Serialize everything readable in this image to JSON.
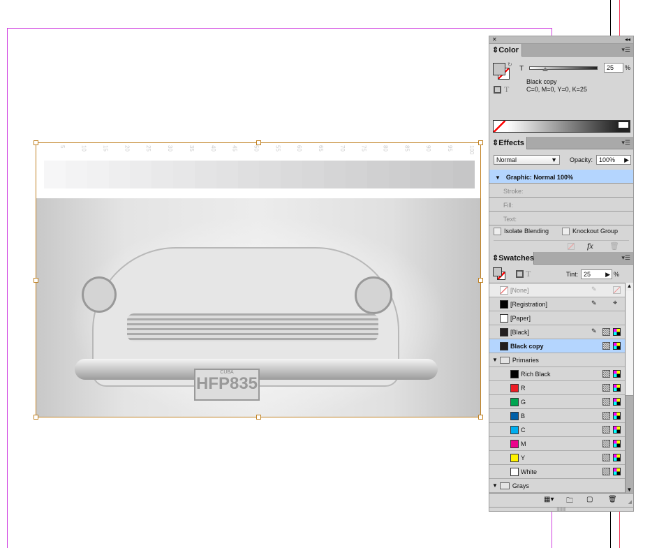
{
  "canvas": {
    "gradient_ticks": [
      "5",
      "10",
      "15",
      "20",
      "25",
      "30",
      "35",
      "40",
      "45",
      "50",
      "55",
      "60",
      "65",
      "70",
      "75",
      "80",
      "85",
      "90",
      "95",
      "100"
    ],
    "license_plate": "HFP835",
    "plate_top": "CUBA"
  },
  "panel": {
    "color": {
      "tab": "Color",
      "slider_label": "T",
      "tint_value": "25",
      "percent": "%",
      "swatch_name": "Black copy",
      "values": "C=0, M=0, Y=0, K=25",
      "tint_level": 25
    },
    "effects": {
      "tab": "Effects",
      "blend_mode": "Normal",
      "opacity_label": "Opacity:",
      "opacity_value": "100%",
      "levels": [
        {
          "label": "Graphic: Normal 100%"
        },
        {
          "label": "Stroke:"
        },
        {
          "label": "Fill:"
        },
        {
          "label": "Text:"
        }
      ],
      "isolate": "Isolate Blending",
      "knockout": "Knockout Group",
      "fx": "fx"
    },
    "swatches": {
      "tab": "Swatches",
      "tint_label": "Tint:",
      "tint_value": "25",
      "percent": "%",
      "items": [
        {
          "name": "[None]",
          "color": "none",
          "indent": 0
        },
        {
          "name": "[Registration]",
          "color": "#000000",
          "indent": 0
        },
        {
          "name": "[Paper]",
          "color": "#ffffff",
          "indent": 0
        },
        {
          "name": "[Black]",
          "color": "#231f20",
          "indent": 0
        },
        {
          "name": "Black copy",
          "color": "#231f20",
          "indent": 0,
          "selected": true
        },
        {
          "name": "Primaries",
          "folder": true
        },
        {
          "name": "Rich Black",
          "color": "#000000",
          "indent": 1
        },
        {
          "name": "R",
          "color": "#ed1c24",
          "indent": 1
        },
        {
          "name": "G",
          "color": "#00a651",
          "indent": 1
        },
        {
          "name": "B",
          "color": "#0060a8",
          "indent": 1
        },
        {
          "name": "C",
          "color": "#00aeef",
          "indent": 1
        },
        {
          "name": "M",
          "color": "#ec008c",
          "indent": 1
        },
        {
          "name": "Y",
          "color": "#fff200",
          "indent": 1
        },
        {
          "name": "White",
          "color": "#ffffff",
          "indent": 1
        },
        {
          "name": "Grays",
          "folder": true
        }
      ]
    }
  }
}
